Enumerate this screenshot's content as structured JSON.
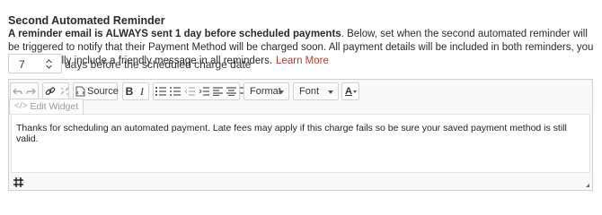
{
  "section": {
    "title": "Second Automated Reminder",
    "desc_bold": "A reminder email is ALWAYS sent 1 day before scheduled payments",
    "desc_rest": ". Below, set when the second automated reminder will be triggered to notify that their Payment Method will be charged soon. All payment details will be included in both reminders, you can optionally include a friendly message in all reminders.",
    "learn_more": "Learn More"
  },
  "stepper": {
    "value": "7",
    "label": "days before the scheduled charge date"
  },
  "editor": {
    "source_label": "Source",
    "format_label": "Format",
    "font_label": "Font",
    "text_color_label": "A",
    "edit_widget_label": "Edit Widget",
    "content": "Thanks for scheduling an automated payment. Late fees may apply if this charge fails so be sure your saved payment method is still valid."
  },
  "colors": {
    "link": "#c0392b",
    "toolbar_bg": "#f8f8f8",
    "border": "#d1d1d1"
  }
}
